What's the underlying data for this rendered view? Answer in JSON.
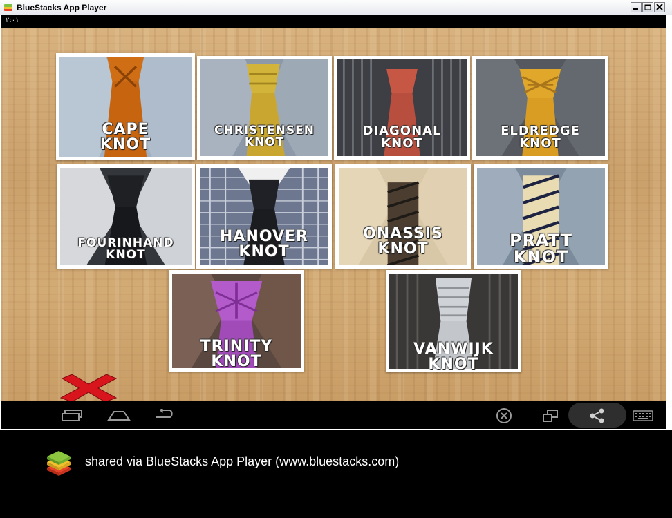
{
  "window": {
    "title": "BlueStacks App Player",
    "app_icon": "bluestacks-logo",
    "controls": [
      "minimize-icon",
      "maximize-icon",
      "close-icon"
    ]
  },
  "status_bar": {
    "clock": "٢:٠١"
  },
  "knots": [
    {
      "line1": "CAPE",
      "line2": "KNOT"
    },
    {
      "line1": "CHRISTENSEN",
      "line2": "KNOT"
    },
    {
      "line1": "DIAGONAL",
      "line2": "KNOT"
    },
    {
      "line1": "ELDREDGE",
      "line2": "KNOT"
    },
    {
      "line1": "FOURINHAND",
      "line2": "KNOT"
    },
    {
      "line1": "HANOVER",
      "line2": "KNOT"
    },
    {
      "line1": "ONASSIS",
      "line2": "KNOT"
    },
    {
      "line1": "PRATT",
      "line2": "KNOT"
    },
    {
      "line1": "TRINITY",
      "line2": "KNOT"
    },
    {
      "line1": "VANWIJK",
      "line2": "KNOT"
    }
  ],
  "exit_icon": "red-x-icon",
  "navbar": {
    "left": [
      "recent-apps-icon",
      "home-icon",
      "back-icon"
    ],
    "right": [
      "close-app-icon",
      "screen-rotate-icon",
      "share-icon",
      "keyboard-icon"
    ]
  },
  "footer": {
    "logo": "bluestacks-logo",
    "caption": "shared via BlueStacks App Player (www.bluestacks.com)"
  },
  "colors": {
    "accent_red": "#d8141c",
    "wood": "#d2aa74",
    "tile_border": "#ffffff"
  }
}
